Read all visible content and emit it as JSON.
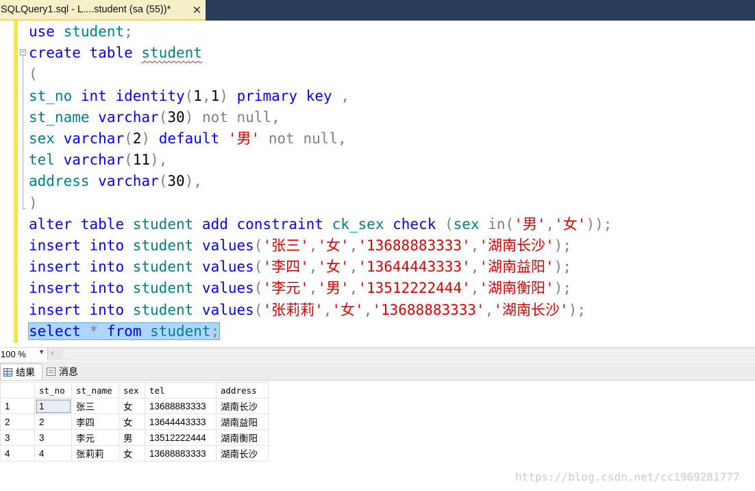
{
  "document_tab": {
    "title": "SQLQuery1.sql - L....student (sa (55))*",
    "close_glyph": "✕"
  },
  "editor": {
    "lines": [
      [
        {
          "t": "use",
          "c": "kw"
        },
        {
          "t": " "
        },
        {
          "t": "student",
          "c": "obj"
        },
        {
          "t": ";",
          "c": "op"
        }
      ],
      [
        {
          "t": "create",
          "c": "kw"
        },
        {
          "t": " "
        },
        {
          "t": "table",
          "c": "kw"
        },
        {
          "t": " "
        },
        {
          "t": "student",
          "c": "obj squiggle"
        }
      ],
      [
        {
          "t": "(",
          "c": "op"
        }
      ],
      [
        {
          "t": "st_no",
          "c": "obj"
        },
        {
          "t": " "
        },
        {
          "t": "int",
          "c": "kw"
        },
        {
          "t": " "
        },
        {
          "t": "identity",
          "c": "kw"
        },
        {
          "t": "(",
          "c": "op"
        },
        {
          "t": "1",
          "c": "num"
        },
        {
          "t": ",",
          "c": "op"
        },
        {
          "t": "1",
          "c": "num"
        },
        {
          "t": ")",
          "c": "op"
        },
        {
          "t": " "
        },
        {
          "t": "primary",
          "c": "kw"
        },
        {
          "t": " "
        },
        {
          "t": "key",
          "c": "kw"
        },
        {
          "t": " "
        },
        {
          "t": ",",
          "c": "op"
        }
      ],
      [
        {
          "t": "st_name",
          "c": "obj"
        },
        {
          "t": " "
        },
        {
          "t": "varchar",
          "c": "kw"
        },
        {
          "t": "(",
          "c": "op"
        },
        {
          "t": "30",
          "c": "num"
        },
        {
          "t": ")",
          "c": "op"
        },
        {
          "t": " "
        },
        {
          "t": "not",
          "c": "op"
        },
        {
          "t": " "
        },
        {
          "t": "null",
          "c": "op"
        },
        {
          "t": ",",
          "c": "op"
        }
      ],
      [
        {
          "t": "sex",
          "c": "obj"
        },
        {
          "t": " "
        },
        {
          "t": "varchar",
          "c": "kw"
        },
        {
          "t": "(",
          "c": "op"
        },
        {
          "t": "2",
          "c": "num"
        },
        {
          "t": ")",
          "c": "op"
        },
        {
          "t": " "
        },
        {
          "t": "default",
          "c": "kw"
        },
        {
          "t": " "
        },
        {
          "t": "'男'",
          "c": "str"
        },
        {
          "t": " "
        },
        {
          "t": "not",
          "c": "op"
        },
        {
          "t": " "
        },
        {
          "t": "null",
          "c": "op"
        },
        {
          "t": ",",
          "c": "op"
        }
      ],
      [
        {
          "t": "tel",
          "c": "obj"
        },
        {
          "t": " "
        },
        {
          "t": "varchar",
          "c": "kw"
        },
        {
          "t": "(",
          "c": "op"
        },
        {
          "t": "11",
          "c": "num"
        },
        {
          "t": ")",
          "c": "op"
        },
        {
          "t": ",",
          "c": "op"
        }
      ],
      [
        {
          "t": "address",
          "c": "obj"
        },
        {
          "t": " "
        },
        {
          "t": "varchar",
          "c": "kw"
        },
        {
          "t": "(",
          "c": "op"
        },
        {
          "t": "30",
          "c": "num"
        },
        {
          "t": ")",
          "c": "op"
        },
        {
          "t": ",",
          "c": "op"
        }
      ],
      [
        {
          "t": ")",
          "c": "op"
        }
      ],
      [
        {
          "t": "alter",
          "c": "kw"
        },
        {
          "t": " "
        },
        {
          "t": "table",
          "c": "kw"
        },
        {
          "t": " "
        },
        {
          "t": "student",
          "c": "obj"
        },
        {
          "t": " "
        },
        {
          "t": "add",
          "c": "kw"
        },
        {
          "t": " "
        },
        {
          "t": "constraint",
          "c": "kw"
        },
        {
          "t": " "
        },
        {
          "t": "ck_sex",
          "c": "obj"
        },
        {
          "t": " "
        },
        {
          "t": "check",
          "c": "kw"
        },
        {
          "t": " "
        },
        {
          "t": "(",
          "c": "op"
        },
        {
          "t": "sex",
          "c": "obj"
        },
        {
          "t": " "
        },
        {
          "t": "in",
          "c": "op"
        },
        {
          "t": "(",
          "c": "op"
        },
        {
          "t": "'男'",
          "c": "str"
        },
        {
          "t": ",",
          "c": "op"
        },
        {
          "t": "'女'",
          "c": "str"
        },
        {
          "t": "));",
          "c": "op"
        }
      ],
      [
        {
          "t": "insert",
          "c": "kw"
        },
        {
          "t": " "
        },
        {
          "t": "into",
          "c": "kw"
        },
        {
          "t": " "
        },
        {
          "t": "student",
          "c": "obj"
        },
        {
          "t": " "
        },
        {
          "t": "values",
          "c": "kw"
        },
        {
          "t": "(",
          "c": "op"
        },
        {
          "t": "'张三'",
          "c": "str"
        },
        {
          "t": ",",
          "c": "op"
        },
        {
          "t": "'女'",
          "c": "str"
        },
        {
          "t": ",",
          "c": "op"
        },
        {
          "t": "'13688883333'",
          "c": "str"
        },
        {
          "t": ",",
          "c": "op"
        },
        {
          "t": "'湖南长沙'",
          "c": "str"
        },
        {
          "t": ");",
          "c": "op"
        }
      ],
      [
        {
          "t": "insert",
          "c": "kw"
        },
        {
          "t": " "
        },
        {
          "t": "into",
          "c": "kw"
        },
        {
          "t": " "
        },
        {
          "t": "student",
          "c": "obj"
        },
        {
          "t": " "
        },
        {
          "t": "values",
          "c": "kw"
        },
        {
          "t": "(",
          "c": "op"
        },
        {
          "t": "'李四'",
          "c": "str"
        },
        {
          "t": ",",
          "c": "op"
        },
        {
          "t": "'女'",
          "c": "str"
        },
        {
          "t": ",",
          "c": "op"
        },
        {
          "t": "'13644443333'",
          "c": "str"
        },
        {
          "t": ",",
          "c": "op"
        },
        {
          "t": "'湖南益阳'",
          "c": "str"
        },
        {
          "t": ");",
          "c": "op"
        }
      ],
      [
        {
          "t": "insert",
          "c": "kw"
        },
        {
          "t": " "
        },
        {
          "t": "into",
          "c": "kw"
        },
        {
          "t": " "
        },
        {
          "t": "student",
          "c": "obj"
        },
        {
          "t": " "
        },
        {
          "t": "values",
          "c": "kw"
        },
        {
          "t": "(",
          "c": "op"
        },
        {
          "t": "'李元'",
          "c": "str"
        },
        {
          "t": ",",
          "c": "op"
        },
        {
          "t": "'男'",
          "c": "str"
        },
        {
          "t": ",",
          "c": "op"
        },
        {
          "t": "'13512222444'",
          "c": "str"
        },
        {
          "t": ",",
          "c": "op"
        },
        {
          "t": "'湖南衡阳'",
          "c": "str"
        },
        {
          "t": ");",
          "c": "op"
        }
      ],
      [
        {
          "t": "insert",
          "c": "kw"
        },
        {
          "t": " "
        },
        {
          "t": "into",
          "c": "kw"
        },
        {
          "t": " "
        },
        {
          "t": "student",
          "c": "obj"
        },
        {
          "t": " "
        },
        {
          "t": "values",
          "c": "kw"
        },
        {
          "t": "(",
          "c": "op"
        },
        {
          "t": "'张莉莉'",
          "c": "str"
        },
        {
          "t": ",",
          "c": "op"
        },
        {
          "t": "'女'",
          "c": "str"
        },
        {
          "t": ",",
          "c": "op"
        },
        {
          "t": "'13688883333'",
          "c": "str"
        },
        {
          "t": ",",
          "c": "op"
        },
        {
          "t": "'湖南长沙'",
          "c": "str"
        },
        {
          "t": ");",
          "c": "op"
        }
      ],
      [
        {
          "t": "select",
          "c": "kw"
        },
        {
          "t": " "
        },
        {
          "t": "*",
          "c": "op"
        },
        {
          "t": " "
        },
        {
          "t": "from",
          "c": "kw"
        },
        {
          "t": " "
        },
        {
          "t": "student",
          "c": "obj"
        },
        {
          "t": ";",
          "c": "op"
        }
      ]
    ],
    "selected_line_index": 14
  },
  "zoom": {
    "value": "100 %",
    "arrow": "▼",
    "scroll_left_glyph": "‹"
  },
  "result_tabs": [
    {
      "label": "结果",
      "icon": "grid-icon",
      "active": true
    },
    {
      "label": "消息",
      "icon": "message-icon",
      "active": false
    }
  ],
  "results_grid": {
    "columns": [
      "",
      "st_no",
      "st_name",
      "sex",
      "tel",
      "address"
    ],
    "rows": [
      [
        "1",
        "1",
        "张三",
        "女",
        "13688883333",
        "湖南长沙"
      ],
      [
        "2",
        "2",
        "李四",
        "女",
        "13644443333",
        "湖南益阳"
      ],
      [
        "3",
        "3",
        "李元",
        "男",
        "13512222444",
        "湖南衡阳"
      ],
      [
        "4",
        "4",
        "张莉莉",
        "女",
        "13688883333",
        "湖南长沙"
      ]
    ],
    "selected_cell": [
      0,
      1
    ]
  },
  "watermark": "https://blog.csdn.net/cc1969281777",
  "colors": {
    "keyword": "#0000ff",
    "object": "#008080",
    "string": "#e00000",
    "operator": "#808080",
    "selection": "#add6ff",
    "margin": "#f2e74a",
    "tab_strip": "#2b3c5a"
  }
}
